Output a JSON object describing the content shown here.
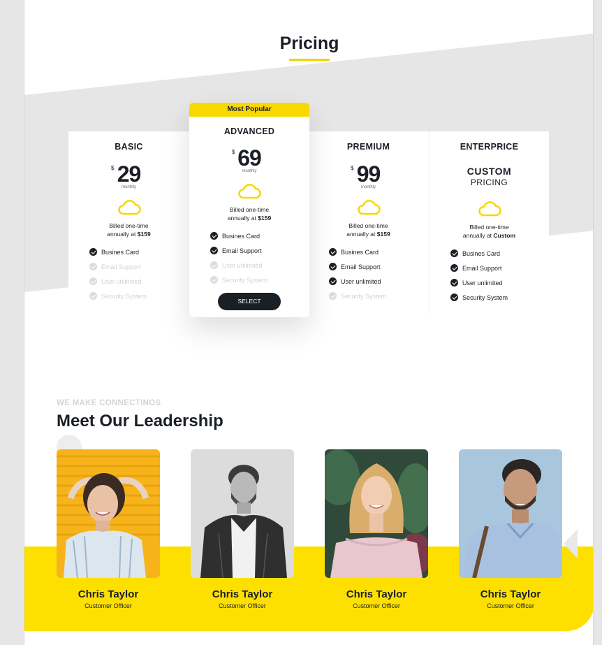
{
  "pricing": {
    "title": "Pricing",
    "plans": [
      {
        "name": "BASIC",
        "currency": "$",
        "price": "29",
        "period": "monthly",
        "billed_line1": "Billed one-time",
        "billed_prefix": "annually at",
        "billed_amount": "$159",
        "features": [
          {
            "label": "Busines Card",
            "included": true
          },
          {
            "label": "Email Support",
            "included": false
          },
          {
            "label": "User unlimited",
            "included": false
          },
          {
            "label": "Security System",
            "included": false
          }
        ]
      },
      {
        "name": "ADVANCED",
        "badge": "Most Popular",
        "currency": "$",
        "price": "69",
        "period": "monthly",
        "billed_line1": "Billed one-time",
        "billed_prefix": "annually at",
        "billed_amount": "$159",
        "features": [
          {
            "label": "Busines Card",
            "included": true
          },
          {
            "label": "Email Support",
            "included": true
          },
          {
            "label": "User unlimited",
            "included": false
          },
          {
            "label": "Security System",
            "included": false
          }
        ],
        "button": "SELECT"
      },
      {
        "name": "PREMIUM",
        "currency": "$",
        "price": "99",
        "period": "monthly",
        "billed_line1": "Billed one-time",
        "billed_prefix": "annually at",
        "billed_amount": "$159",
        "features": [
          {
            "label": "Busines Card",
            "included": true
          },
          {
            "label": "Email Support",
            "included": true
          },
          {
            "label": "User unlimited",
            "included": true
          },
          {
            "label": "Security System",
            "included": false
          }
        ]
      },
      {
        "name": "ENTERPRICE",
        "custom_line1": "CUSTOM",
        "custom_line2": "PRICING",
        "billed_line1": "Billed one-time",
        "billed_prefix": "annually at",
        "billed_amount": "Custom",
        "features": [
          {
            "label": "Busines Card",
            "included": true
          },
          {
            "label": "Email Support",
            "included": true
          },
          {
            "label": "User unlimited",
            "included": true
          },
          {
            "label": "Security System",
            "included": true
          }
        ]
      }
    ]
  },
  "leadership": {
    "overline": "WE MAKE CONNECTINOS",
    "title": "Meet Our Leadership",
    "members": [
      {
        "name": "Chris Taylor",
        "role": "Customer Officer"
      },
      {
        "name": "Chris Taylor",
        "role": "Customer Officer"
      },
      {
        "name": "Chris Taylor",
        "role": "Customer Officer"
      },
      {
        "name": "Chris Taylor",
        "role": "Customer Officer"
      }
    ]
  },
  "colors": {
    "accent": "#fde000",
    "dark": "#1b1f26",
    "muted": "#d2d2d2",
    "background_band": "#e6e6e6"
  }
}
